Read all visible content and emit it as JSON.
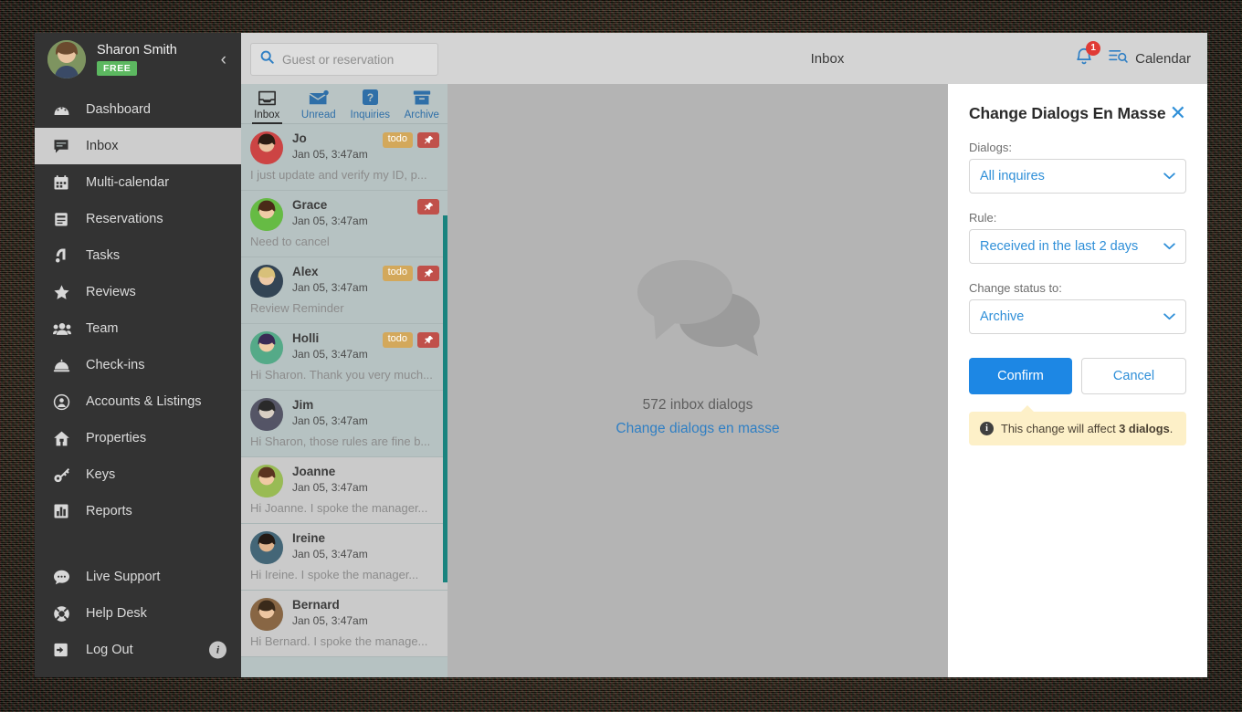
{
  "sidebar": {
    "profile": {
      "name": "Sharon Smith",
      "plan_badge": "FREE",
      "collapse_icon": "chevron-left-icon"
    },
    "items": [
      {
        "label": "Dashboard",
        "icon": "dashboard-icon",
        "active": false
      },
      {
        "label": "Inbox",
        "icon": "inbox-chat-icon",
        "active": true
      },
      {
        "label": "Multi-calendar",
        "icon": "calendar-icon",
        "active": false
      },
      {
        "label": "Reservations",
        "icon": "reservations-icon",
        "active": false
      },
      {
        "label": "Tasks",
        "icon": "tasks-icon",
        "active": false
      },
      {
        "label": "Reviews",
        "icon": "star-icon",
        "active": false
      },
      {
        "label": "Team",
        "icon": "team-icon",
        "active": false
      },
      {
        "label": "Check-ins",
        "icon": "bell-desk-icon",
        "active": false
      },
      {
        "label": "Accounts & Listings",
        "icon": "account-circle-icon",
        "active": false
      },
      {
        "label": "Properties",
        "icon": "home-icon",
        "active": false
      },
      {
        "label": "Keys",
        "icon": "key-icon",
        "active": false
      },
      {
        "label": "Reports",
        "icon": "bar-chart-icon",
        "active": false
      }
    ],
    "bottom_items": [
      {
        "label": "Live Support",
        "icon": "chat-bubble-icon"
      },
      {
        "label": "Help Desk",
        "icon": "lifebuoy-icon"
      },
      {
        "label": "Log Out",
        "icon": "logout-icon",
        "trailing_icon": "info-icon"
      }
    ]
  },
  "search": {
    "placeholder": "Guest or reservation",
    "icon": "search-icon",
    "value": ""
  },
  "tabs": [
    {
      "label": "Inbox",
      "icon": "inbox-tray-icon",
      "active": true
    },
    {
      "label": "Unread",
      "icon": "unread-envelope-icon",
      "active": false
    },
    {
      "label": "Inquiries",
      "icon": "question-square-icon",
      "active": false
    },
    {
      "label": "Archive",
      "icon": "archive-box-icon",
      "active": false
    }
  ],
  "messages": [
    {
      "name": "Jo",
      "time": "Jan 05, 3:47am",
      "preview": "I just update and verify my ID, p...",
      "todo": "todo",
      "pinned": true,
      "read": false
    },
    {
      "name": "Grace",
      "time": "Jan 05, 3:47am",
      "preview": "Need to cancel",
      "todo": "",
      "pinned": true,
      "read": false
    },
    {
      "name": "Alex",
      "time": "Jan 05, 3:47am",
      "preview": "Review Reminder",
      "todo": "todo",
      "pinned": true,
      "read": false
    },
    {
      "name": "Holli",
      "time": "Jan 05, 3:47am",
      "preview": "Hi Sharon. Thank you very much...",
      "todo": "todo",
      "pinned": true,
      "read": false
    },
    {
      "name": "Jim",
      "time": "Jan 05, 3:47am",
      "preview": "Hi Sharon, those rules are fine b...",
      "todo": "",
      "pinned": false,
      "read": false
    },
    {
      "name": "Joanne",
      "time": "Jan 05, 3:47am",
      "preview": "Hi Joanne. I spoke the manager...",
      "todo": "",
      "pinned": false,
      "read": true
    },
    {
      "name": "Ireine",
      "time": "Jan 05, 3:47am",
      "preview": "Hi Ireine. I spoke the manager...",
      "todo": "",
      "pinned": false,
      "read": true
    },
    {
      "name": "Bernard",
      "time": "Jan 05, 3:47am",
      "preview": "Hi Bernard. I spoke the manage...",
      "todo": "",
      "pinned": false,
      "read": true
    }
  ],
  "topbar": {
    "title": "Inbox",
    "bell_icon": "notification-bell-icon",
    "bell_badge": "1",
    "calendar_icon": "calendar-search-icon",
    "calendar_label": "Calendar"
  },
  "empty_state": {
    "icon": "chat-bubbles-icon",
    "count_text": "572 inbox dialogs",
    "link_text": "Change dialogs en masse"
  },
  "panel": {
    "title": "Change Dialogs En Masse",
    "close_icon": "close-icon",
    "fields": [
      {
        "label": "Dialogs:",
        "value": "All inquires",
        "chevron": "chevron-down-icon"
      },
      {
        "label": "Rule:",
        "value": "Received in the last 2 days",
        "chevron": "chevron-down-icon"
      },
      {
        "label": "Change status to:",
        "value": "Archive",
        "chevron": "chevron-down-icon"
      }
    ],
    "confirm_label": "Confirm",
    "cancel_label": "Cancel",
    "notice": {
      "icon": "info-icon",
      "prefix": "This change will affect ",
      "bold": "3 dialogs",
      "suffix": "."
    }
  },
  "colors": {
    "sidebar_bg": "#333333",
    "accent_blue": "#1d87e4",
    "link_blue": "#2f8fd8",
    "badge_green": "#5cb860",
    "todo_gold": "#d3a85b",
    "pin_red": "#c0504a",
    "notice_yellow": "#fdf0c8",
    "scrollbar_teal": "#19837e",
    "alert_red": "#e03b35"
  }
}
